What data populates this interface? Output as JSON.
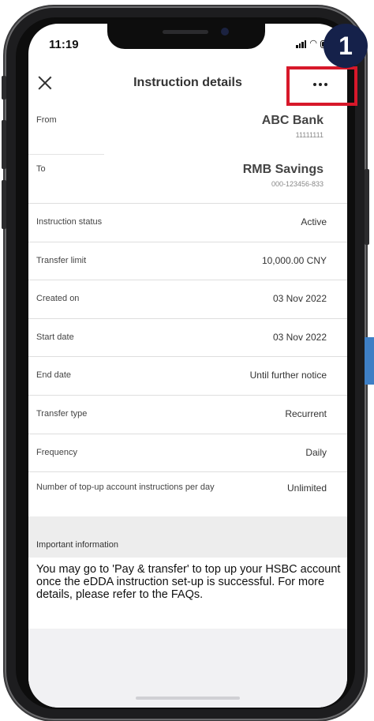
{
  "status_bar": {
    "time": "11:19"
  },
  "header": {
    "title": "Instruction details"
  },
  "annotation": {
    "step_number": "1"
  },
  "from": {
    "label": "From",
    "bank_name": "ABC Bank",
    "account_number": "11111111"
  },
  "to": {
    "label": "To",
    "account_name": "RMB Savings",
    "account_number": "000-123456-833"
  },
  "details": [
    {
      "label": "Instruction status",
      "value": "Active"
    },
    {
      "label": "Transfer limit",
      "value": "10,000.00 CNY"
    },
    {
      "label": "Created on",
      "value": "03 Nov 2022"
    },
    {
      "label": "Start date",
      "value": "03 Nov 2022"
    },
    {
      "label": "End date",
      "value": "Until further notice"
    },
    {
      "label": "Transfer type",
      "value": "Recurrent"
    },
    {
      "label": "Frequency",
      "value": "Daily"
    }
  ],
  "topup": {
    "label": "Number of top-up account instructions per day",
    "value": "Unlimited"
  },
  "important": {
    "header": "Important information",
    "text": "You may go to 'Pay & transfer' to top up your HSBC account once the eDDA instruction set-up is successful. For more details, please refer to the FAQs."
  },
  "colors": {
    "highlight": "#d7182a",
    "badge": "#15214a",
    "side_tab": "#3e7fc5"
  }
}
